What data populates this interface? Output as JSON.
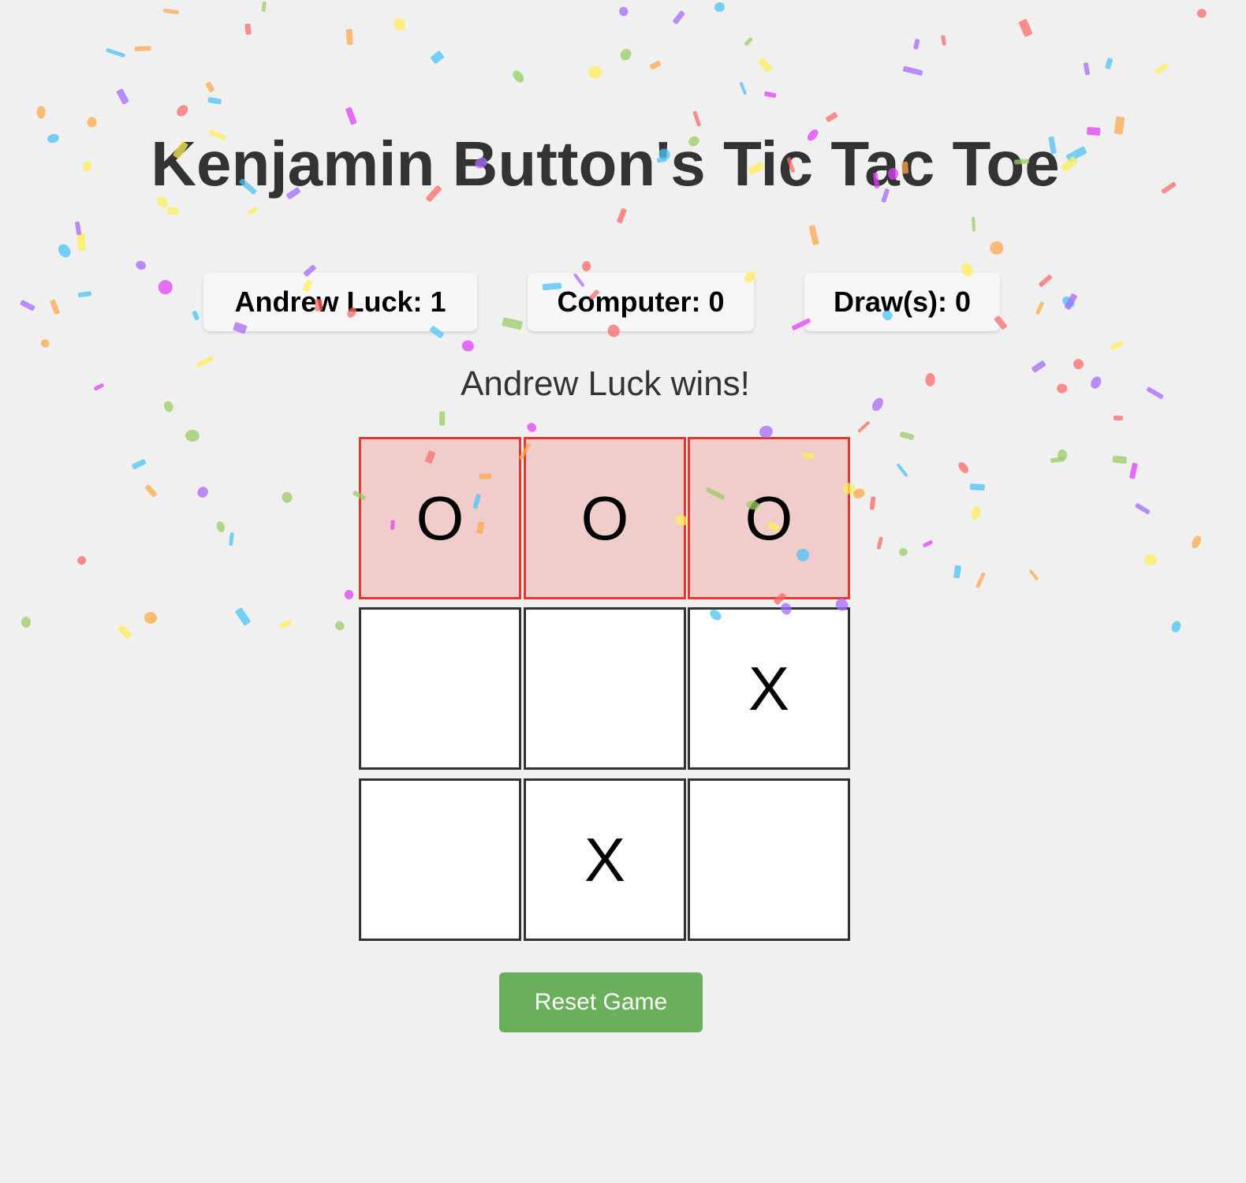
{
  "title": "Kenjamin Button's Tic Tac Toe",
  "scores": {
    "player": "Andrew Luck: 1",
    "computer": "Computer: 0",
    "draws": "Draw(s): 0"
  },
  "status": "Andrew Luck wins!",
  "board": {
    "cells": [
      "O",
      "O",
      "O",
      "",
      "",
      "X",
      "",
      "X",
      ""
    ],
    "winning_cells": [
      0,
      1,
      2
    ]
  },
  "reset_label": "Reset Game",
  "colors": {
    "background": "#f0f0f0",
    "win_cell_fill": "#f0cccb",
    "win_cell_border": "#e33a2f",
    "cell_border": "#333333",
    "reset_button": "#6aaf5c",
    "confetti": [
      "#ff6b6b",
      "#4fc3f7",
      "#a66cff",
      "#ffee58",
      "#9ccc65",
      "#ffa94d",
      "#e040fb"
    ]
  }
}
